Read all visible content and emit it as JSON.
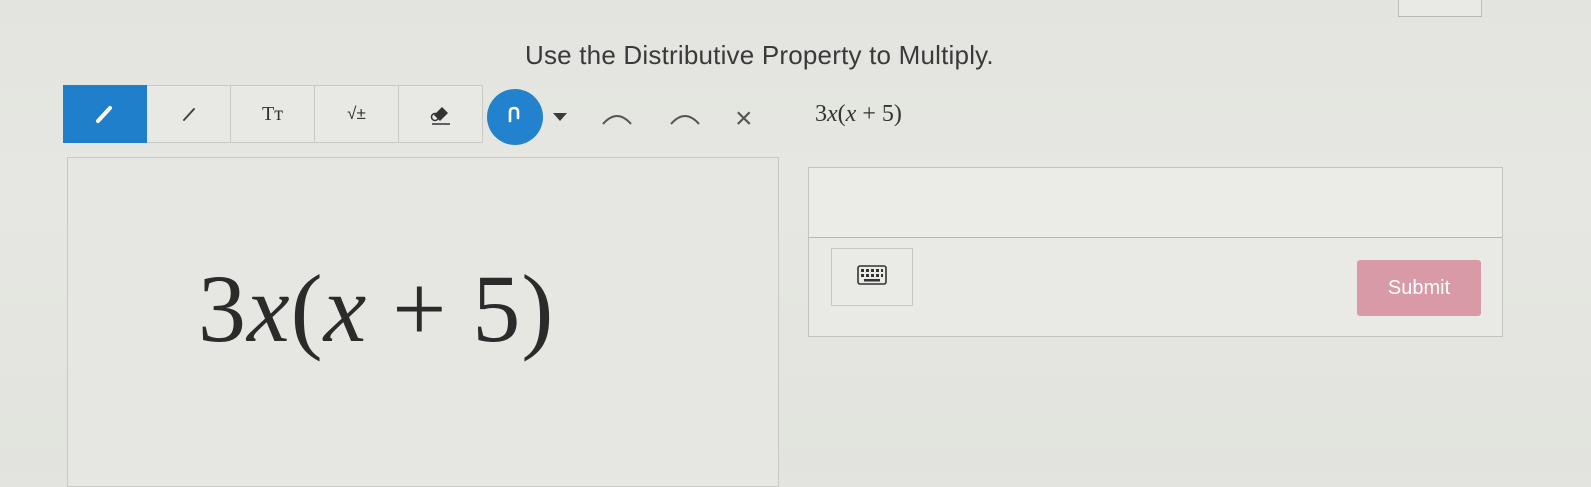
{
  "header": {
    "title": "Use the Distributive Property to Multiply."
  },
  "toolbar": {
    "tools": [
      {
        "name": "pen-icon",
        "active": true
      },
      {
        "name": "line-icon",
        "active": false
      },
      {
        "name": "text-icon",
        "label": "Tт",
        "active": false
      },
      {
        "name": "sqrt-icon",
        "label": "√±",
        "active": false
      },
      {
        "name": "eraser-icon",
        "active": false
      }
    ],
    "redo_icon": "redo-icon",
    "close_label": "×",
    "expression": {
      "coef": "3",
      "var": "x",
      "open": "(",
      "inner_var": "x",
      "op": " + ",
      "num": "5",
      "close": ")"
    }
  },
  "work_area": {
    "expression": {
      "coef": "3",
      "var": "x",
      "open": "(",
      "inner_var": "x",
      "op": " + ",
      "num": "5",
      "close": ")"
    }
  },
  "answer": {
    "value": "",
    "submit_label": "Submit",
    "keyboard_icon": "keyboard-icon"
  },
  "colors": {
    "accent": "#1f7fcb",
    "submit": "#d79aa6"
  }
}
